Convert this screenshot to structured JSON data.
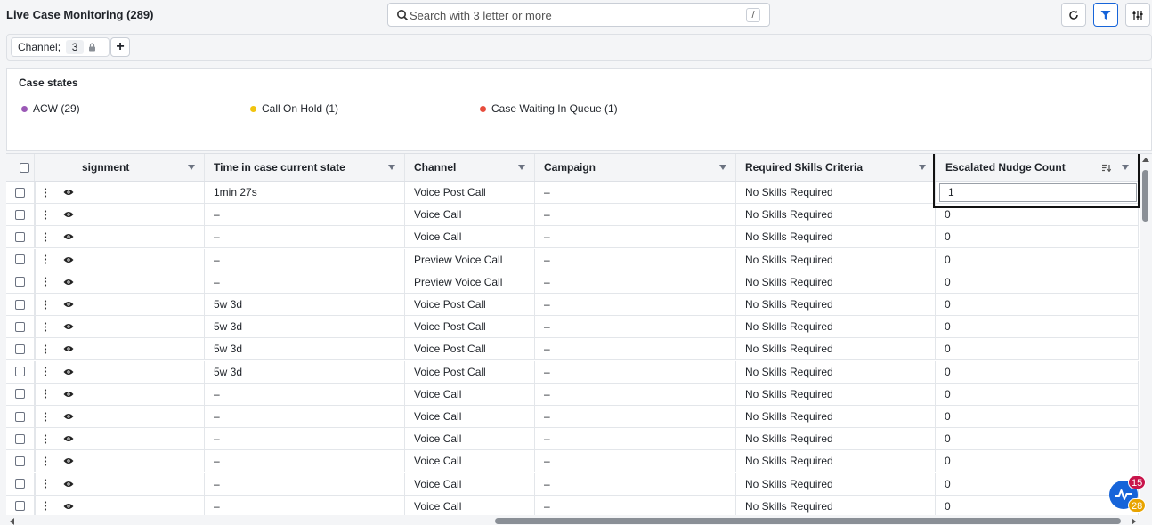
{
  "header": {
    "title": "Live Case Monitoring (289)",
    "search_placeholder": "Search with 3 letter or more",
    "search_shortcut": "/",
    "refresh_icon": "refresh-icon",
    "filter_icon": "filter-icon",
    "columns_icon": "columns-settings-icon",
    "accent_color": "#1664d9"
  },
  "filters": {
    "chip_label": "Channel;",
    "chip_count": "3",
    "add_label": "+"
  },
  "case_states": {
    "title": "Case states",
    "items": [
      {
        "label": "ACW (29)",
        "color": "#9b59b6"
      },
      {
        "label": "Call On Hold (1)",
        "color": "#f1c40f"
      },
      {
        "label": "Case Waiting In Queue (1)",
        "color": "#e74c3c"
      }
    ]
  },
  "grid": {
    "columns": [
      "signment",
      "Time in case current state",
      "Channel",
      "Campaign",
      "Required Skills Criteria",
      "Escalated Nudge Count"
    ],
    "rows": [
      {
        "time": "1min 27s",
        "channel": "Voice Post Call",
        "campaign": "–",
        "skills": "No Skills Required",
        "nudge": "1"
      },
      {
        "time": "–",
        "channel": "Voice Call",
        "campaign": "–",
        "skills": "No Skills Required",
        "nudge": "0"
      },
      {
        "time": "–",
        "channel": "Voice Call",
        "campaign": "–",
        "skills": "No Skills Required",
        "nudge": "0"
      },
      {
        "time": "–",
        "channel": "Preview Voice Call",
        "campaign": "–",
        "skills": "No Skills Required",
        "nudge": "0"
      },
      {
        "time": "–",
        "channel": "Preview Voice Call",
        "campaign": "–",
        "skills": "No Skills Required",
        "nudge": "0"
      },
      {
        "time": "5w 3d",
        "channel": "Voice Post Call",
        "campaign": "–",
        "skills": "No Skills Required",
        "nudge": "0"
      },
      {
        "time": "5w 3d",
        "channel": "Voice Post Call",
        "campaign": "–",
        "skills": "No Skills Required",
        "nudge": "0"
      },
      {
        "time": "5w 3d",
        "channel": "Voice Post Call",
        "campaign": "–",
        "skills": "No Skills Required",
        "nudge": "0"
      },
      {
        "time": "5w 3d",
        "channel": "Voice Post Call",
        "campaign": "–",
        "skills": "No Skills Required",
        "nudge": "0"
      },
      {
        "time": "–",
        "channel": "Voice Call",
        "campaign": "–",
        "skills": "No Skills Required",
        "nudge": "0"
      },
      {
        "time": "–",
        "channel": "Voice Call",
        "campaign": "–",
        "skills": "No Skills Required",
        "nudge": "0"
      },
      {
        "time": "–",
        "channel": "Voice Call",
        "campaign": "–",
        "skills": "No Skills Required",
        "nudge": "0"
      },
      {
        "time": "–",
        "channel": "Voice Call",
        "campaign": "–",
        "skills": "No Skills Required",
        "nudge": "0"
      },
      {
        "time": "–",
        "channel": "Voice Call",
        "campaign": "–",
        "skills": "No Skills Required",
        "nudge": "0"
      },
      {
        "time": "–",
        "channel": "Voice Call",
        "campaign": "–",
        "skills": "No Skills Required",
        "nudge": "0"
      }
    ]
  },
  "widget": {
    "icon": "activity-pulse-icon",
    "badge_top": "15",
    "badge_top_color": "#c8144b",
    "badge_bottom": "28",
    "badge_bottom_color": "#e8a400"
  }
}
